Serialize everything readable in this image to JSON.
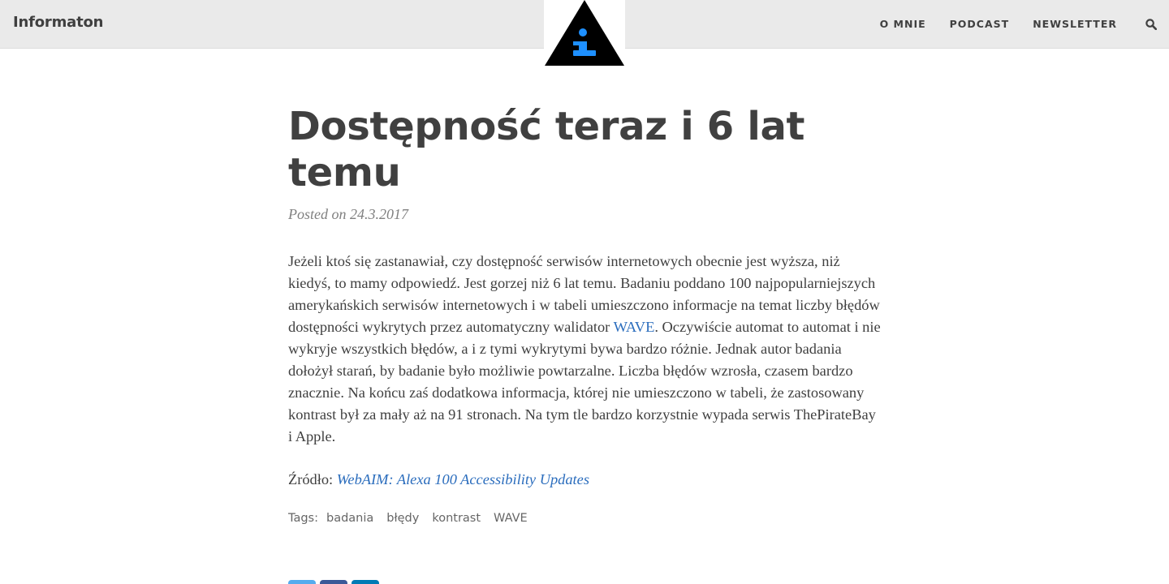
{
  "brand": "Informaton",
  "nav": {
    "items": [
      {
        "label": "O MNIE"
      },
      {
        "label": "PODCAST"
      },
      {
        "label": "NEWSLETTER"
      }
    ],
    "search_icon": "search-icon"
  },
  "logo": {
    "icon": "info-triangle-logo",
    "colors": {
      "triangle": "#000000",
      "glyph": "#1e90ff"
    }
  },
  "post": {
    "title": "Dostępność teraz i 6 lat temu",
    "meta": "Posted on 24.3.2017",
    "body_before_link": "Jeżeli ktoś się zastanawiał, czy dostępność serwisów internetowych obecnie jest wyższa, niż kiedyś, to mamy odpowiedź. Jest gorzej niż 6 lat temu. Badaniu poddano 100 najpopularniejszych amerykańskich serwisów internetowych i w tabeli umieszczono informacje na temat liczby błędów dostępności wykrytych przez automatyczny walidator ",
    "body_link": "WAVE",
    "body_after_link": ". Oczywiście automat to automat i nie wykryje wszystkich błędów, a i z tymi wykrytymi bywa bardzo różnie. Jednak autor badania dołożył starań, by badanie było możliwie powtarzalne. Liczba błędów wzrosła, czasem bardzo znacznie. Na końcu zaś dodatkowa informacja, której nie umieszczono w tabeli, że zastosowany kontrast był za mały aż na 91 stronach. Na tym tle bardzo korzystnie wypada serwis ThePirateBay i Apple.",
    "source_label": "Źródło:",
    "source_link": "WebAIM: Alexa 100 Accessibility Updates",
    "tags_label": "Tags:",
    "tags": [
      "badania",
      "błędy",
      "kontrast",
      "WAVE"
    ]
  },
  "share": [
    {
      "icon": "twitter-icon",
      "color": "#55acee"
    },
    {
      "icon": "facebook-icon",
      "color": "#3b5998"
    },
    {
      "icon": "linkedin-icon",
      "color": "#007bb5"
    }
  ],
  "colors": {
    "navbar_bg": "#eaeaea",
    "text": "#404040",
    "link": "#2b6dbd",
    "meta": "#808080"
  }
}
